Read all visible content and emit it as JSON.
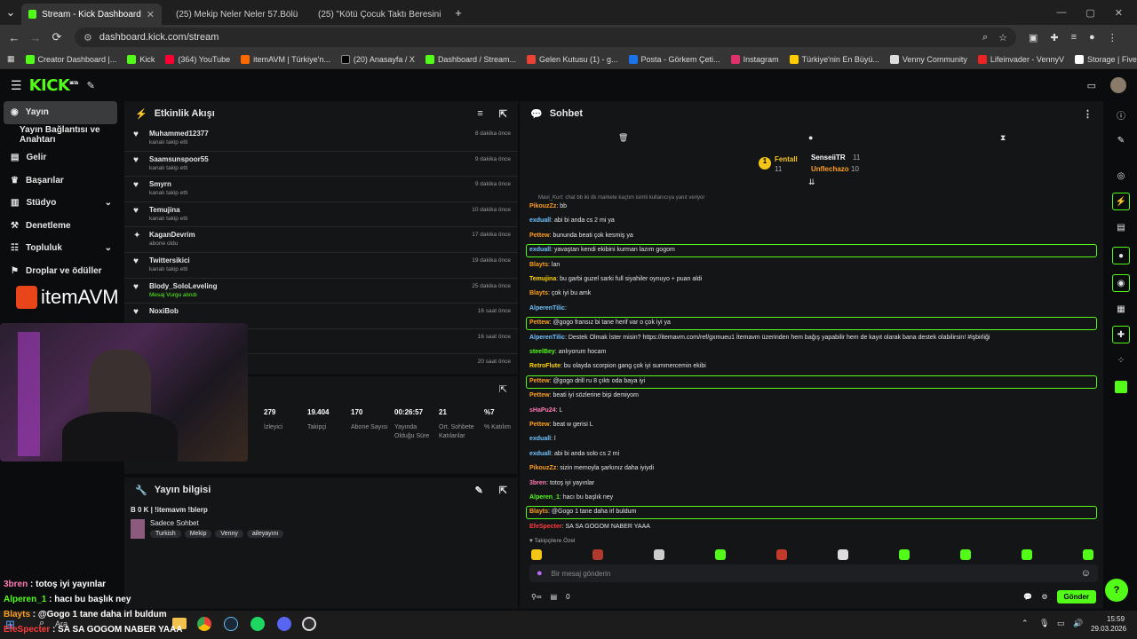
{
  "browser": {
    "tabs": [
      {
        "title": "Stream - Kick Dashboard",
        "active": true
      },
      {
        "title": "(25) Mekip Neler Neler 57.Bölü",
        "active": false
      },
      {
        "title": "(25) \"Kötü Çocuk Taktı Beresini",
        "active": false
      }
    ],
    "url": "dashboard.kick.com/stream",
    "bookmarks": [
      "Creator Dashboard |...",
      "Kick",
      "(364) YouTube",
      "itemAVM | Türkiye'n...",
      "(20) Anasayfa / X",
      "Dashboard / Stream...",
      "Gelen Kutusu (1) - g...",
      "Posta - Görkem Çeti...",
      "Instagram",
      "Türkiye'nin En Büyü...",
      "Venny Community",
      "Lifeinvader - VennyV",
      "Storage | Fivemanage"
    ]
  },
  "app": {
    "logo": "KICK",
    "logo_sup": "BETA",
    "accent": "#53fc18"
  },
  "sidebar": {
    "items": [
      {
        "label": "Yayın",
        "icon": "broadcast-icon"
      },
      {
        "label": "Yayın Bağlantısı ve Anahtarı",
        "icon": ""
      },
      {
        "label": "Gelir",
        "icon": "money-icon"
      },
      {
        "label": "Başarılar",
        "icon": "trophy-icon"
      },
      {
        "label": "Stüdyo",
        "icon": "studio-icon"
      },
      {
        "label": "Denetleme",
        "icon": "hammer-icon"
      },
      {
        "label": "Topluluk",
        "icon": "community-icon"
      },
      {
        "label": "Droplar ve ödüller",
        "icon": "gift-icon"
      }
    ],
    "sponsor": "itemAVM"
  },
  "activity": {
    "title": "Etkinlik Akışı",
    "events": [
      {
        "name": "Muhammed12377",
        "action": "kanalı takip etti",
        "time": "8 dakika önce"
      },
      {
        "name": "Saamsunspoor55",
        "action": "kanalı takip etti",
        "time": "9 dakika önce"
      },
      {
        "name": "Smyrn",
        "action": "kanalı takip etti",
        "time": "9 dakika önce"
      },
      {
        "name": "Temujina",
        "action": "kanalı takip etti",
        "time": "10 dakika önce"
      },
      {
        "name": "KaganDevrim",
        "action": "abone oldu",
        "time": "17 dakika önce"
      },
      {
        "name": "Twittersikici",
        "action": "kanalı takip etti",
        "time": "19 dakika önce"
      },
      {
        "name": "Blody_SoloLeveling",
        "action": "Mesaj Vurgu alındı",
        "time": "25 dakika önce"
      },
      {
        "name": "NoxiBob",
        "action": "",
        "time": "16 saat önce"
      },
      {
        "name": "",
        "action": "",
        "time": "16 saat önce"
      },
      {
        "name": "",
        "action": "",
        "time": "20 saat önce"
      }
    ]
  },
  "stats": [
    {
      "value": "279",
      "label": "İzleyici"
    },
    {
      "value": "19.404",
      "label": "Takipçi"
    },
    {
      "value": "170",
      "label": "Abone Sayısı"
    },
    {
      "value": "00:26:57",
      "label": "Yayında Olduğu Süre"
    },
    {
      "value": "21",
      "label": "Ort. Sohbete Katılanlar"
    },
    {
      "value": "%7",
      "label": "% Katılım"
    }
  ],
  "stream_info": {
    "title": "Yayın bilgisi",
    "stream_title": "B 0 K | !itemavm !blerp",
    "category": "Sadece Sohbet",
    "tags": [
      "Turkish",
      "Mekip",
      "Venny",
      "aileyayını"
    ]
  },
  "chat": {
    "title": "Sohbet",
    "leaderboard": [
      {
        "name": "Fentall",
        "value": "11"
      },
      {
        "name": "SenseiiTR",
        "value": "11"
      },
      {
        "name": "Unflechazo",
        "value": "10"
      }
    ],
    "reply_hint": "Mavi_Kurt: chat bb iki dk markete kaçtım isimli kullanıcıya yanıt veriyor",
    "messages": [
      {
        "user": "PikouzZz",
        "text": "bb",
        "color": "#ff9f1c",
        "hl": false
      },
      {
        "user": "exduall",
        "text": "abi bi anda cs 2 mi ya",
        "color": "#6fc3ff",
        "hl": false
      },
      {
        "user": "Pettew",
        "text": "bununda beati çok kesmiş ya",
        "color": "#ff9f1c",
        "hl": false
      },
      {
        "user": "exduall",
        "text": "yavaştan kendi ekibini kurman lazım gogom",
        "color": "#6fc3ff",
        "hl": true
      },
      {
        "user": "Blayts",
        "text": "lan",
        "color": "#ff9f1c",
        "hl": false
      },
      {
        "user": "Temujina",
        "text": "bu garbi guzel sarki full siyahiler oynuyo + puan aldi",
        "color": "#ffd400",
        "hl": false
      },
      {
        "user": "Blayts",
        "text": "çok iyi bu amk",
        "color": "#ff9f1c",
        "hl": false
      },
      {
        "user": "AlperenTilic",
        "text": "",
        "color": "#6fc3ff",
        "hl": false
      },
      {
        "user": "Pettew",
        "text": "@gogo fransız bi tane herif var o çok iyi ya",
        "color": "#ff9f1c",
        "hl": true
      },
      {
        "user": "AlperenTilic",
        "text": "Destek Olmak İster misin? https://itemavm.com/ref/gxmueu1 İtemavm üzerinden hem bağış yapabilir hem de kayıt olarak bana destek olabilirsin! #işbirliği",
        "color": "#6fc3ff",
        "hl": false
      },
      {
        "user": "steelBey",
        "text": "anlıyorum hocam",
        "color": "#53fc18",
        "hl": false
      },
      {
        "user": "RetroFlute",
        "text": "bu olayda scorpion gang çok iyi summercemin ekibi",
        "color": "#ffd400",
        "hl": false
      },
      {
        "user": "Pettew",
        "text": "@gogo drill ru 8 çıktı oda baya iyi",
        "color": "#ff9f1c",
        "hl": true
      },
      {
        "user": "Pettew",
        "text": "beati iyi sözlerine bişi demiyom",
        "color": "#ff9f1c",
        "hl": false
      },
      {
        "user": "sHaPu24",
        "text": "L",
        "color": "#ff7ab6",
        "hl": false
      },
      {
        "user": "Pettew",
        "text": "beat w gerisi L",
        "color": "#ff9f1c",
        "hl": false
      },
      {
        "user": "exduall",
        "text": "l",
        "color": "#6fc3ff",
        "hl": false
      },
      {
        "user": "exduall",
        "text": "abi bi anda solo cs 2 mi",
        "color": "#6fc3ff",
        "hl": false
      },
      {
        "user": "PikouzZz",
        "text": "sizin memoyla şarkınız daha iyiydi",
        "color": "#ff9f1c",
        "hl": false
      },
      {
        "user": "3bren",
        "text": "totoş iyi yayınlar",
        "color": "#ff7ab6",
        "hl": false
      },
      {
        "user": "Alperen_1",
        "text": "hacı bu başlık ney",
        "color": "#53fc18",
        "hl": false
      },
      {
        "user": "Blayts",
        "text": "@Gogo 1 tane daha irl buldum",
        "color": "#ff9f1c",
        "hl": true
      },
      {
        "user": "EfeSpecter",
        "text": "SA SA GOGOM NABER YAAA",
        "color": "#ff3b3b",
        "hl": false
      }
    ],
    "emote_filter": "Takipçilere Özel",
    "input_placeholder": "Bir mesaj gönderin",
    "points": "0",
    "send_label": "Gönder"
  },
  "overlay": [
    {
      "user": "3bren",
      "text": "totoş iyi yayınlar",
      "color": "#ff7ab6"
    },
    {
      "user": "Alperen_1",
      "text": "hacı bu başlık ney",
      "color": "#53fc18"
    },
    {
      "user": "Blayts",
      "text": "@Gogo 1 tane daha irl buldum",
      "color": "#ff9f1c"
    },
    {
      "user": "EfeSpecter",
      "text": "SA SA GOGOM NABER YAAA",
      "color": "#ff3b3b"
    }
  ],
  "taskbar": {
    "search": "Ara",
    "time": "15:59",
    "date": "29.03.2026"
  }
}
